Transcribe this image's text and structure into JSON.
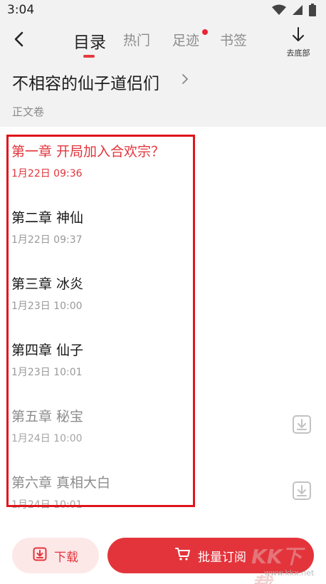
{
  "status_bar": {
    "time": "3:04",
    "icons": [
      "wifi-icon",
      "signal-icon",
      "battery-icon"
    ]
  },
  "nav": {
    "back_icon": "back-arrow-icon",
    "tabs": [
      {
        "label": "目录",
        "active": true
      },
      {
        "label": "热门",
        "active": false
      },
      {
        "label": "足迹",
        "active": false,
        "has_dot": true
      },
      {
        "label": "书签",
        "active": false
      }
    ],
    "go_bottom_label": "去底部",
    "go_bottom_icon": "arrow-down-icon"
  },
  "book": {
    "title": "不相容的仙子道侣们",
    "volume": "正文卷"
  },
  "chapters": [
    {
      "title": "第一章 开局加入合欢宗？",
      "date": "1月22日 09:36",
      "state": "current"
    },
    {
      "title": "第二章 神仙",
      "date": "1月22日 09:37",
      "state": "normal"
    },
    {
      "title": "第三章 冰炎",
      "date": "1月23日 10:00",
      "state": "normal"
    },
    {
      "title": "第四章 仙子",
      "date": "1月23日 10:01",
      "state": "normal"
    },
    {
      "title": "第五章 秘宝",
      "date": "1月24日 10:00",
      "state": "locked",
      "download_icon": "download-icon"
    },
    {
      "title": "第六章 真相大白",
      "date": "1月24日 10:01",
      "state": "locked",
      "download_icon": "download-icon"
    }
  ],
  "bottom": {
    "download_label": "下载",
    "batch_label": "批量订阅"
  },
  "watermark": {
    "main": "KK下载",
    "url": "www.kkx.net"
  },
  "colors": {
    "accent": "#e3343c",
    "highlight_box": "#e0141c"
  }
}
